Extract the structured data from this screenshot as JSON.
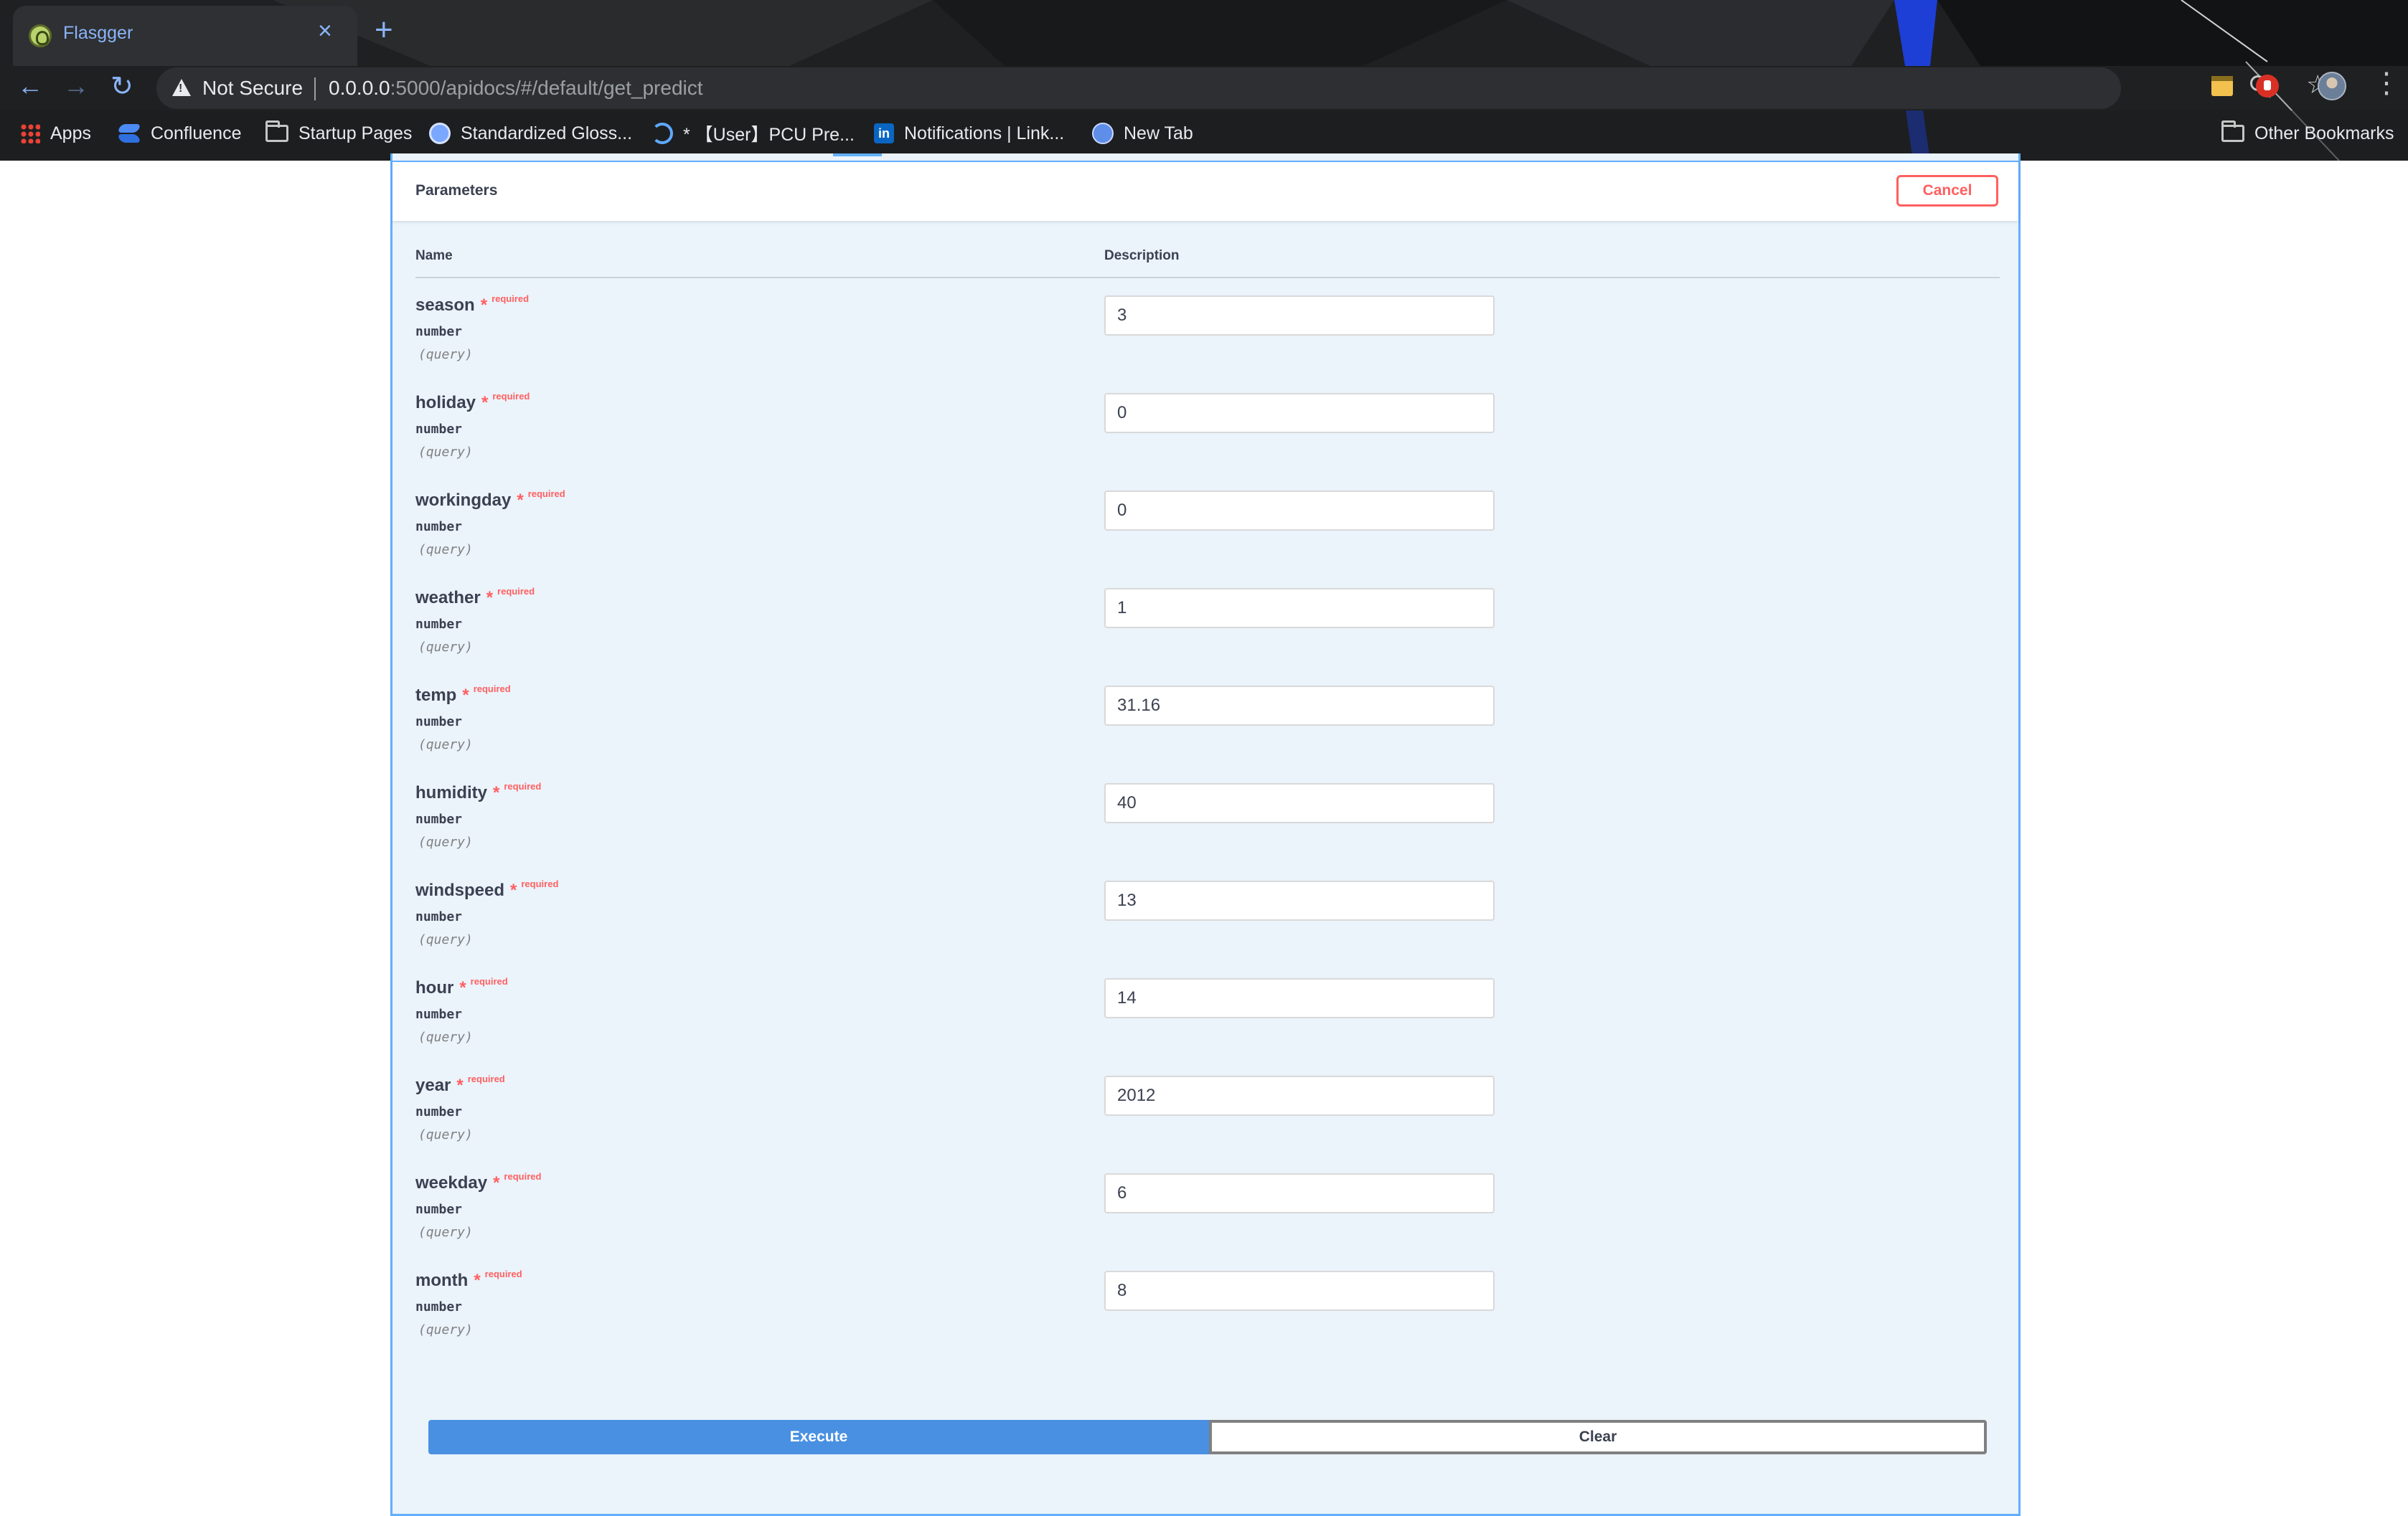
{
  "browser": {
    "tab_title": "Flasgger",
    "tab_close": "×",
    "new_tab": "+",
    "security_label": "Not Secure",
    "url_host": "0.0.0.0",
    "url_rest": ":5000/apidocs/#/default/get_predict",
    "icons": {
      "back": "arrow-left",
      "forward": "arrow-right",
      "reload": "reload",
      "zoom": "magnifier",
      "star": "star",
      "menu": "kebab"
    },
    "bookmarks": [
      {
        "label": "Apps",
        "icon": "apps-grid-icon"
      },
      {
        "label": "Confluence",
        "icon": "confluence-icon"
      },
      {
        "label": "Startup Pages",
        "icon": "folder-icon"
      },
      {
        "label": "Standardized Gloss...",
        "icon": "globe-icon"
      },
      {
        "label": "* 【User】PCU Pre...",
        "icon": "pcu-icon"
      },
      {
        "label": "Notifications | Link...",
        "icon": "linkedin-icon"
      },
      {
        "label": "New Tab",
        "icon": "globe-icon"
      }
    ],
    "other_bookmarks": "Other Bookmarks"
  },
  "colors": {
    "accent_blue": "#61affe",
    "execute_blue": "#4990e2",
    "cancel_red": "#ff6060",
    "panel_bg": "#ebf3fb"
  },
  "parameters_section": {
    "title": "Parameters",
    "cancel_label": "Cancel",
    "col_name": "Name",
    "col_description": "Description",
    "required_star": "*",
    "required_label": "required",
    "params": [
      {
        "name": "season",
        "type": "number",
        "in": "(query)",
        "value": "3"
      },
      {
        "name": "holiday",
        "type": "number",
        "in": "(query)",
        "value": "0"
      },
      {
        "name": "workingday",
        "type": "number",
        "in": "(query)",
        "value": "0"
      },
      {
        "name": "weather",
        "type": "number",
        "in": "(query)",
        "value": "1"
      },
      {
        "name": "temp",
        "type": "number",
        "in": "(query)",
        "value": "31.16"
      },
      {
        "name": "humidity",
        "type": "number",
        "in": "(query)",
        "value": "40"
      },
      {
        "name": "windspeed",
        "type": "number",
        "in": "(query)",
        "value": "13"
      },
      {
        "name": "hour",
        "type": "number",
        "in": "(query)",
        "value": "14"
      },
      {
        "name": "year",
        "type": "number",
        "in": "(query)",
        "value": "2012"
      },
      {
        "name": "weekday",
        "type": "number",
        "in": "(query)",
        "value": "6"
      },
      {
        "name": "month",
        "type": "number",
        "in": "(query)",
        "value": "8"
      }
    ]
  },
  "actions": {
    "execute_label": "Execute",
    "clear_label": "Clear"
  }
}
